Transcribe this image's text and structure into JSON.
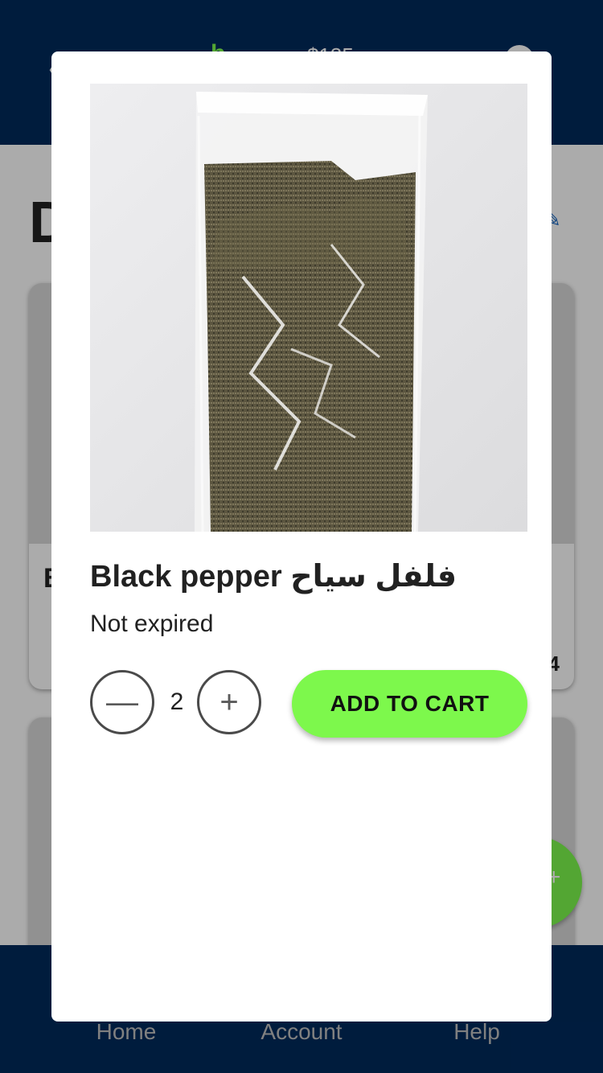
{
  "appbar": {
    "back_icon": "arrow-back-icon",
    "logo_text": "b",
    "cart_total": "$135",
    "avatar_icon": "account-circle-icon"
  },
  "page": {
    "heading": "D",
    "edit_icon": "edit-icon"
  },
  "cards": [
    {
      "title": "B",
      "meta": "4"
    },
    {
      "title": "",
      "meta": ""
    }
  ],
  "fab": {
    "icon": "add-icon"
  },
  "bottom_nav": {
    "items": [
      {
        "label": "Home",
        "icon": "home-icon"
      },
      {
        "label": "Account",
        "icon": "account-icon"
      },
      {
        "label": "Help",
        "icon": "help-icon"
      }
    ]
  },
  "dialog": {
    "product_name": "Black pepper فلفل سياح",
    "status": "Not expired",
    "quantity": "2",
    "minus_icon": "minus-icon",
    "plus_icon": "plus-icon",
    "add_to_cart_label": "ADD TO CART"
  },
  "colors": {
    "primary": "#002a5c",
    "accent": "#7df84c",
    "text": "#212121"
  }
}
